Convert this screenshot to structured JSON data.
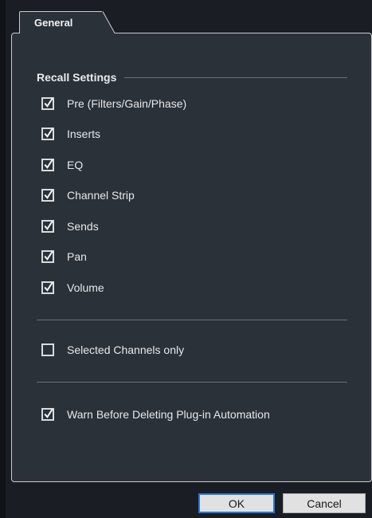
{
  "tabs": [
    {
      "label": "General",
      "active": true
    }
  ],
  "recall_settings": {
    "title": "Recall Settings",
    "items": [
      {
        "label": "Pre (Filters/Gain/Phase)",
        "checked": true
      },
      {
        "label": "Inserts",
        "checked": true
      },
      {
        "label": "EQ",
        "checked": true
      },
      {
        "label": "Channel Strip",
        "checked": true
      },
      {
        "label": "Sends",
        "checked": true
      },
      {
        "label": "Pan",
        "checked": true
      },
      {
        "label": "Volume",
        "checked": true
      }
    ]
  },
  "options": {
    "selected_channels_only": {
      "label": "Selected Channels only",
      "checked": false
    },
    "warn_before_deleting": {
      "label": "Warn Before Deleting Plug-in Automation",
      "checked": true
    }
  },
  "buttons": {
    "ok_label": "OK",
    "cancel_label": "Cancel"
  },
  "colors": {
    "background": "#0f1318",
    "panel": "#2b3138",
    "border": "#c8ccd0",
    "text": "#e6e8eb",
    "button_focus": "#2a78d4"
  }
}
